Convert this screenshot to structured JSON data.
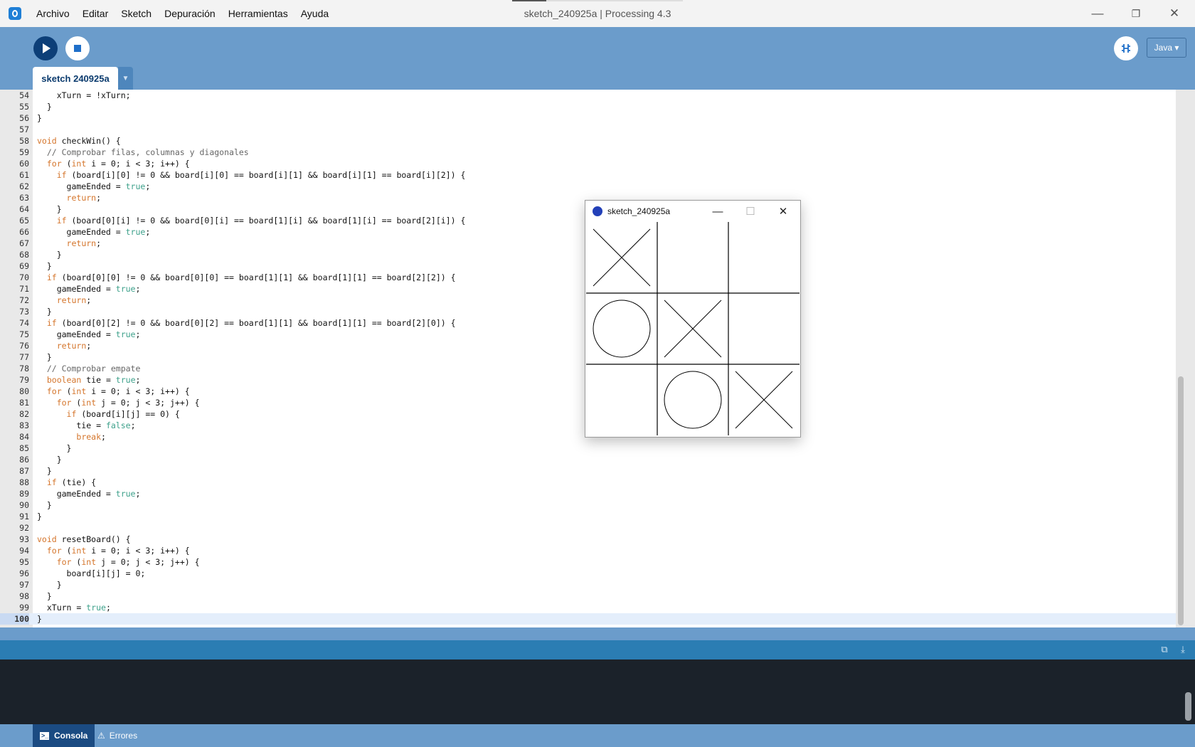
{
  "window": {
    "title": "sketch_240925a | Processing 4.3",
    "menu": [
      "Archivo",
      "Editar",
      "Sketch",
      "Depuración",
      "Herramientas",
      "Ayuda"
    ],
    "controls": {
      "minimize": "—",
      "restore": "❐",
      "close": "✕"
    }
  },
  "toolbar": {
    "run_icon": "play-icon",
    "stop_icon": "stop-icon",
    "debug_icon": "debugger-icon",
    "mode_label": "Java ▾"
  },
  "tab": {
    "label": "sketch 240925a",
    "menu_arrow": "▼"
  },
  "editor": {
    "current_line": 100,
    "lines": [
      {
        "n": "54",
        "t": "    xTurn = !xTurn;"
      },
      {
        "n": "55",
        "t": "  }"
      },
      {
        "n": "56",
        "t": "}"
      },
      {
        "n": "57",
        "t": ""
      },
      {
        "n": "58",
        "t": "void checkWin() {"
      },
      {
        "n": "59",
        "t": "  // Comprobar filas, columnas y diagonales"
      },
      {
        "n": "60",
        "t": "  for (int i = 0; i < 3; i++) {"
      },
      {
        "n": "61",
        "t": "    if (board[i][0] != 0 && board[i][0] == board[i][1] && board[i][1] == board[i][2]) {"
      },
      {
        "n": "62",
        "t": "      gameEnded = true;"
      },
      {
        "n": "63",
        "t": "      return;"
      },
      {
        "n": "64",
        "t": "    }"
      },
      {
        "n": "65",
        "t": "    if (board[0][i] != 0 && board[0][i] == board[1][i] && board[1][i] == board[2][i]) {"
      },
      {
        "n": "66",
        "t": "      gameEnded = true;"
      },
      {
        "n": "67",
        "t": "      return;"
      },
      {
        "n": "68",
        "t": "    }"
      },
      {
        "n": "69",
        "t": "  }"
      },
      {
        "n": "70",
        "t": "  if (board[0][0] != 0 && board[0][0] == board[1][1] && board[1][1] == board[2][2]) {"
      },
      {
        "n": "71",
        "t": "    gameEnded = true;"
      },
      {
        "n": "72",
        "t": "    return;"
      },
      {
        "n": "73",
        "t": "  }"
      },
      {
        "n": "74",
        "t": "  if (board[0][2] != 0 && board[0][2] == board[1][1] && board[1][1] == board[2][0]) {"
      },
      {
        "n": "75",
        "t": "    gameEnded = true;"
      },
      {
        "n": "76",
        "t": "    return;"
      },
      {
        "n": "77",
        "t": "  }"
      },
      {
        "n": "78",
        "t": "  // Comprobar empate"
      },
      {
        "n": "79",
        "t": "  boolean tie = true;"
      },
      {
        "n": "80",
        "t": "  for (int i = 0; i < 3; i++) {"
      },
      {
        "n": "81",
        "t": "    for (int j = 0; j < 3; j++) {"
      },
      {
        "n": "82",
        "t": "      if (board[i][j] == 0) {"
      },
      {
        "n": "83",
        "t": "        tie = false;"
      },
      {
        "n": "84",
        "t": "        break;"
      },
      {
        "n": "85",
        "t": "      }"
      },
      {
        "n": "86",
        "t": "    }"
      },
      {
        "n": "87",
        "t": "  }"
      },
      {
        "n": "88",
        "t": "  if (tie) {"
      },
      {
        "n": "89",
        "t": "    gameEnded = true;"
      },
      {
        "n": "90",
        "t": "  }"
      },
      {
        "n": "91",
        "t": "}"
      },
      {
        "n": "92",
        "t": ""
      },
      {
        "n": "93",
        "t": "void resetBoard() {"
      },
      {
        "n": "94",
        "t": "  for (int i = 0; i < 3; i++) {"
      },
      {
        "n": "95",
        "t": "    for (int j = 0; j < 3; j++) {"
      },
      {
        "n": "96",
        "t": "      board[i][j] = 0;"
      },
      {
        "n": "97",
        "t": "    }"
      },
      {
        "n": "98",
        "t": "  }"
      },
      {
        "n": "99",
        "t": "  xTurn = true;"
      },
      {
        "n": "100",
        "t": "}"
      }
    ]
  },
  "console": {
    "tabs": [
      {
        "label": "Consola",
        "icon": "terminal-icon",
        "active": true
      },
      {
        "label": "Errores",
        "icon": "warning-icon",
        "active": false
      }
    ],
    "header_icons": [
      "expand-icon",
      "collapse-icon"
    ]
  },
  "sketch_window": {
    "title": "sketch_240925a",
    "controls": {
      "minimize": "—",
      "maximize": "☐",
      "close": "✕"
    },
    "board": [
      [
        "X",
        "",
        ""
      ],
      [
        "O",
        "X",
        ""
      ],
      [
        "",
        "O",
        "X"
      ]
    ]
  }
}
